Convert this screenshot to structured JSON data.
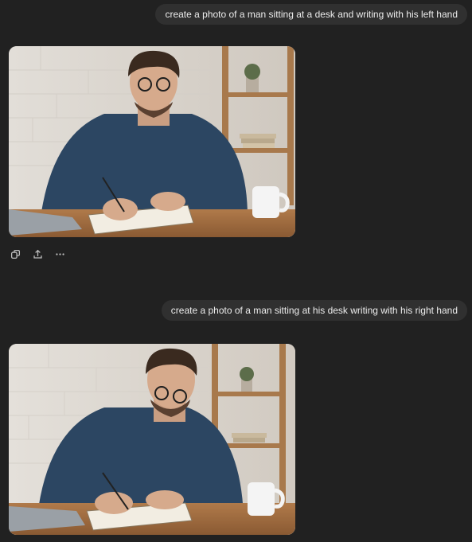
{
  "conversation": {
    "messages": [
      {
        "role": "user",
        "text": "create a photo of a man sitting at a desk and writing with his left hand"
      },
      {
        "role": "assistant",
        "type": "image",
        "alt": "generated image"
      },
      {
        "role": "user",
        "text": "create a photo of a man sitting at his desk writing with his right hand"
      },
      {
        "role": "assistant",
        "type": "image",
        "alt": "generated image"
      }
    ],
    "action_icons": [
      "copy-icon",
      "share-icon",
      "more-icon"
    ]
  },
  "colors": {
    "background": "#212121",
    "bubble": "#303030",
    "text": "#ececec",
    "icon": "#bdbdbd"
  }
}
